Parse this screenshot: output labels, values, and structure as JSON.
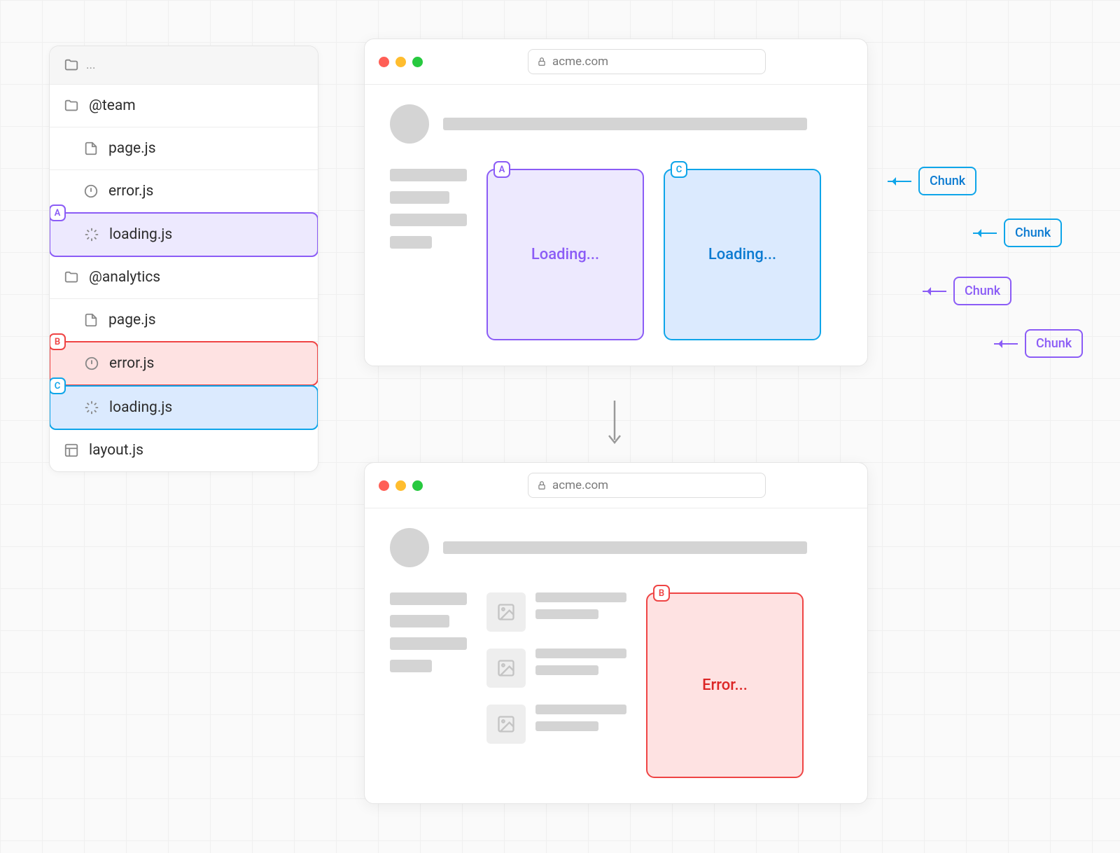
{
  "fileExplorer": {
    "header_dots": "...",
    "items": [
      {
        "icon": "folder",
        "label": "@team"
      },
      {
        "icon": "file",
        "label": "page.js"
      },
      {
        "icon": "error",
        "label": "error.js"
      },
      {
        "icon": "spinner",
        "label": "loading.js",
        "badge": "A"
      },
      {
        "icon": "folder",
        "label": "@analytics"
      },
      {
        "icon": "file",
        "label": "page.js"
      },
      {
        "icon": "error",
        "label": "error.js",
        "badge": "B"
      },
      {
        "icon": "spinner",
        "label": "loading.js",
        "badge": "C"
      },
      {
        "icon": "layout",
        "label": "layout.js"
      }
    ]
  },
  "browserTop": {
    "url": "acme.com",
    "cards": [
      {
        "badge": "A",
        "text": "Loading..."
      },
      {
        "badge": "C",
        "text": "Loading..."
      }
    ]
  },
  "browserBottom": {
    "url": "acme.com",
    "errorCard": {
      "badge": "B",
      "text": "Error..."
    }
  },
  "chunks": {
    "label": "Chunk"
  }
}
